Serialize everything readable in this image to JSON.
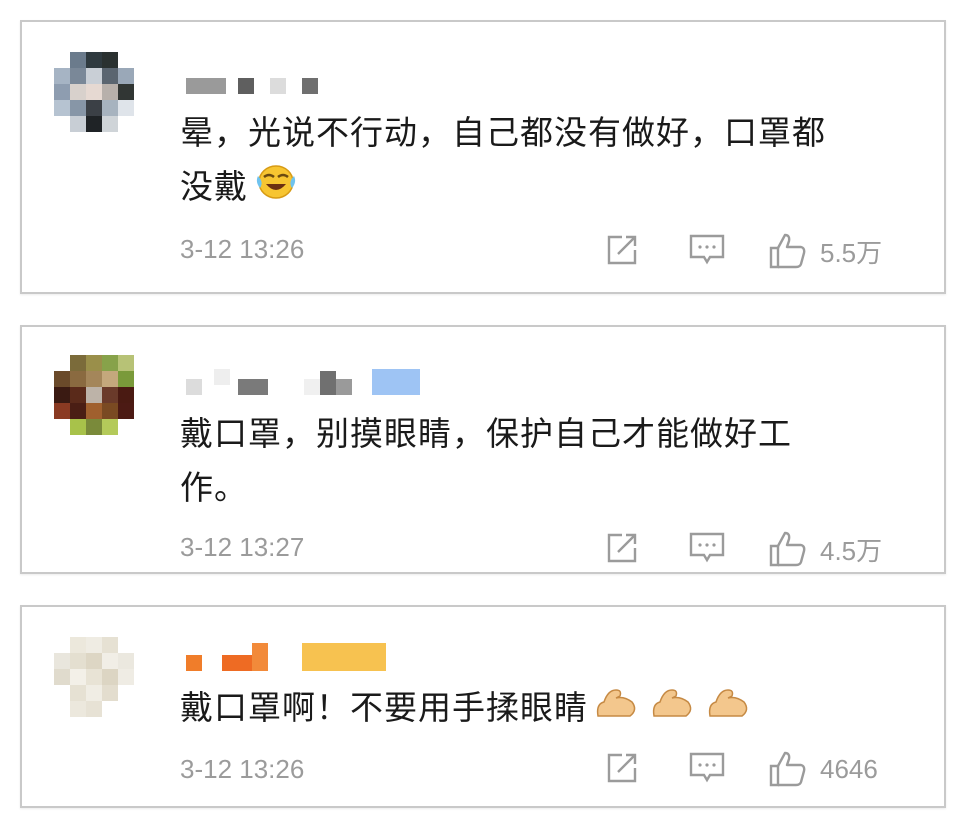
{
  "comments": [
    {
      "text_line1": "晕，光说不行动，自己都没有做好，口罩都",
      "text_line2": "没戴",
      "emoji": "laughing-crying-emoji",
      "time": "3-12 13:26",
      "likes": "5.5万"
    },
    {
      "text_line1": "戴口罩，别摸眼睛，保护自己才能做好工",
      "text_line2": "作。",
      "time": "3-12 13:27",
      "likes": "4.5万"
    },
    {
      "text_line1": "戴口罩啊！不要用手揉眼睛",
      "emoji": "flexed-biceps-emoji",
      "time": "3-12 13:26",
      "likes": "4646"
    }
  ],
  "icons": {
    "share": "share-icon",
    "comment": "comment-icon",
    "like": "thumbs-up-icon"
  },
  "colors": {
    "text": "#1a1a1a",
    "meta": "#9b9b9b",
    "border": "#c9c9c9"
  }
}
